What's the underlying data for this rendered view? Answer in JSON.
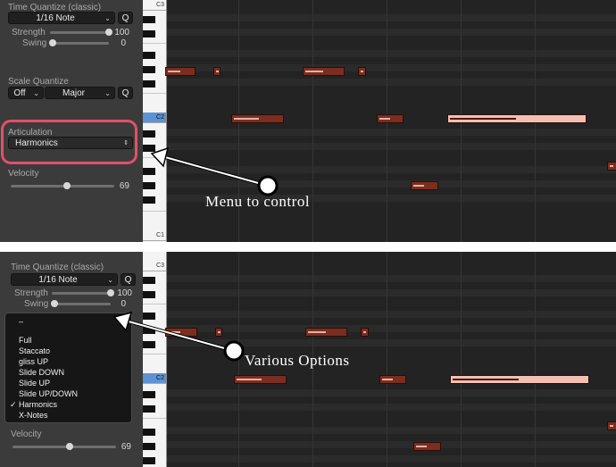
{
  "top": {
    "time_quantize": {
      "label": "Time Quantize (classic)",
      "value": "1/16 Note",
      "q_label": "Q",
      "strength_label": "Strength",
      "strength_value": "100",
      "strength_level": 1.0,
      "swing_label": "Swing",
      "swing_value": "0",
      "swing_level": 0.0
    },
    "scale_quantize": {
      "label": "Scale Quantize",
      "root_value": "Off",
      "scale_value": "Major",
      "q_label": "Q"
    },
    "articulation": {
      "label": "Articulation",
      "value": "Harmonics"
    },
    "velocity": {
      "label": "Velocity",
      "value": "69",
      "level": 0.54
    },
    "piano": {
      "c3_label": "C3",
      "c2_label": "C2",
      "c1_label": "C1"
    },
    "callout": "Menu to control"
  },
  "bottom": {
    "time_quantize": {
      "label": "Time Quantize (classic)",
      "value": "1/16 Note",
      "q_label": "Q",
      "strength_label": "Strength",
      "strength_value": "100",
      "strength_level": 1.0,
      "swing_label": "Swing",
      "swing_value": "0",
      "swing_level": 0.0
    },
    "menu": {
      "items": [
        "–",
        "Full",
        "Staccato",
        "gliss UP",
        "Slide DOWN",
        "Slide UP",
        "Slide UP/DOWN",
        "Harmonics",
        "X-Notes"
      ],
      "checkmark": "✓",
      "checked_index": 7
    },
    "velocity": {
      "label": "Velocity",
      "value": "69",
      "level": 0.54
    },
    "piano": {
      "c3_label": "C3",
      "c2_label": "C2"
    },
    "callout": "Various Options"
  },
  "colors": {
    "note_fill": "#7a2e20",
    "note_selected": "#f3bfb3",
    "highlight_ring": "#e2506a",
    "c2_key": "#5d93d2"
  }
}
